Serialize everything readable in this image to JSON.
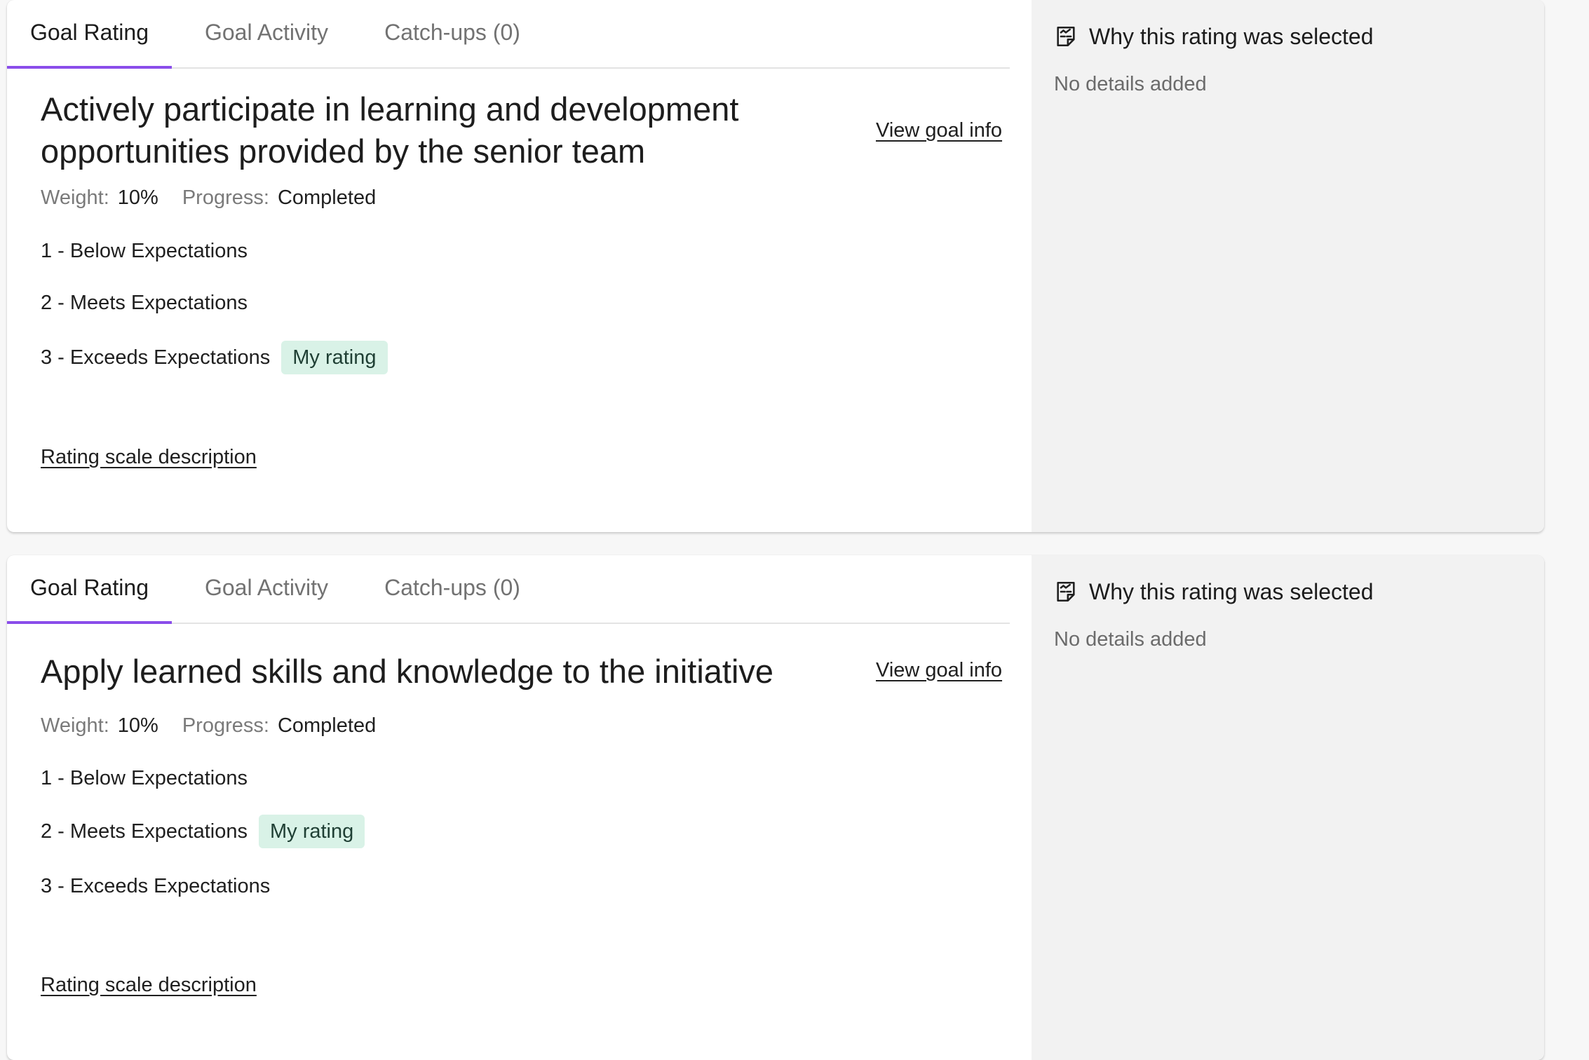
{
  "goals": [
    {
      "tabs": [
        "Goal Rating",
        "Goal Activity",
        "Catch-ups (0)"
      ],
      "title": "Actively participate in learning and development opportunities provided by the senior team",
      "view_link": "View goal info",
      "weight_label": "Weight:",
      "weight_value": "10%",
      "progress_label": "Progress:",
      "progress_value": "Completed",
      "options": [
        "1 - Below Expectations",
        "2 - Meets Expectations",
        "3 - Exceeds Expectations"
      ],
      "my_rating_badge": "My rating",
      "scale_link": "Rating scale description",
      "side_title": "Why this rating was selected",
      "side_empty": "No details added"
    },
    {
      "tabs": [
        "Goal Rating",
        "Goal Activity",
        "Catch-ups (0)"
      ],
      "title": "Apply learned skills and knowledge to the initiative",
      "view_link": "View goal info",
      "weight_label": "Weight:",
      "weight_value": "10%",
      "progress_label": "Progress:",
      "progress_value": "Completed",
      "options": [
        "1 - Below Expectations",
        "2 - Meets Expectations",
        "3 - Exceeds Expectations"
      ],
      "my_rating_badge": "My rating",
      "scale_link": "Rating scale description",
      "side_title": "Why this rating was selected",
      "side_empty": "No details added"
    }
  ],
  "selected_ratings": [
    "3 - Exceeds Expectations",
    "2 - Meets Expectations"
  ],
  "colors": {
    "tab_accent": "#8a4dea",
    "badge_bg": "#d9f2e7",
    "side_bg": "#f2f2f2"
  },
  "icons": {
    "side_header": "notes-chart-icon"
  }
}
